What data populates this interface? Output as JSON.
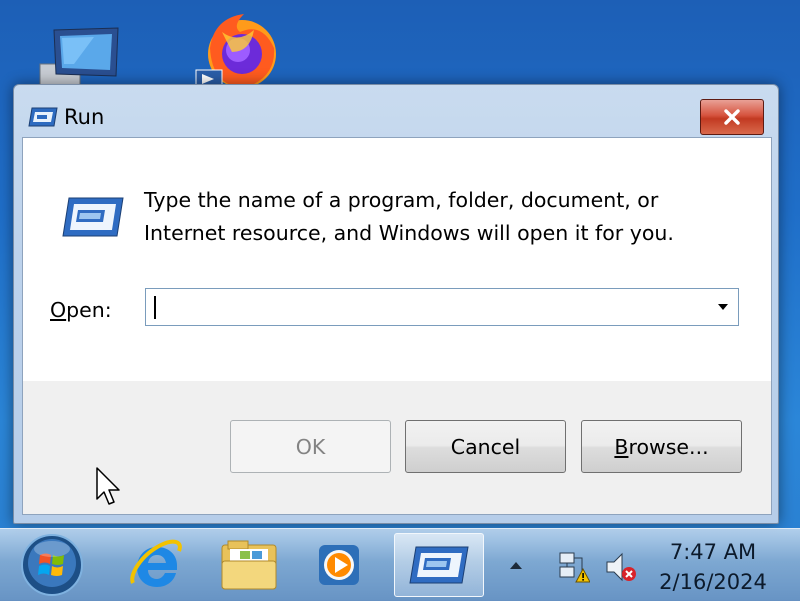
{
  "desktop": {
    "icons": [
      {
        "name": "computer-icon"
      },
      {
        "name": "firefox-icon"
      }
    ]
  },
  "run_dialog": {
    "title": "Run",
    "close_icon": "close-icon",
    "description_line1": "Type the name of a program, folder, document, or",
    "description_line2": "Internet resource, and Windows will open it for you.",
    "open_label_first": "O",
    "open_label_rest": "pen:",
    "open_field_value": "",
    "buttons": {
      "ok": "OK",
      "cancel": "Cancel",
      "browse_first": "B",
      "browse_rest": "rowse..."
    },
    "ok_enabled": false
  },
  "taskbar": {
    "items": [
      "start-orb-icon",
      "internet-explorer-icon",
      "file-explorer-icon",
      "media-player-icon",
      "run-icon"
    ],
    "active_item": "run-icon",
    "tray": {
      "icons": [
        "show-hidden-icons",
        "network-warning-icon",
        "volume-muted-icon"
      ]
    },
    "clock": {
      "time": "7:47 AM",
      "date": "2/16/2024"
    }
  },
  "colors": {
    "close_button": "#c23a22",
    "window_frame": "#bcd2ec",
    "dialog_body": "#f0f0f0"
  }
}
